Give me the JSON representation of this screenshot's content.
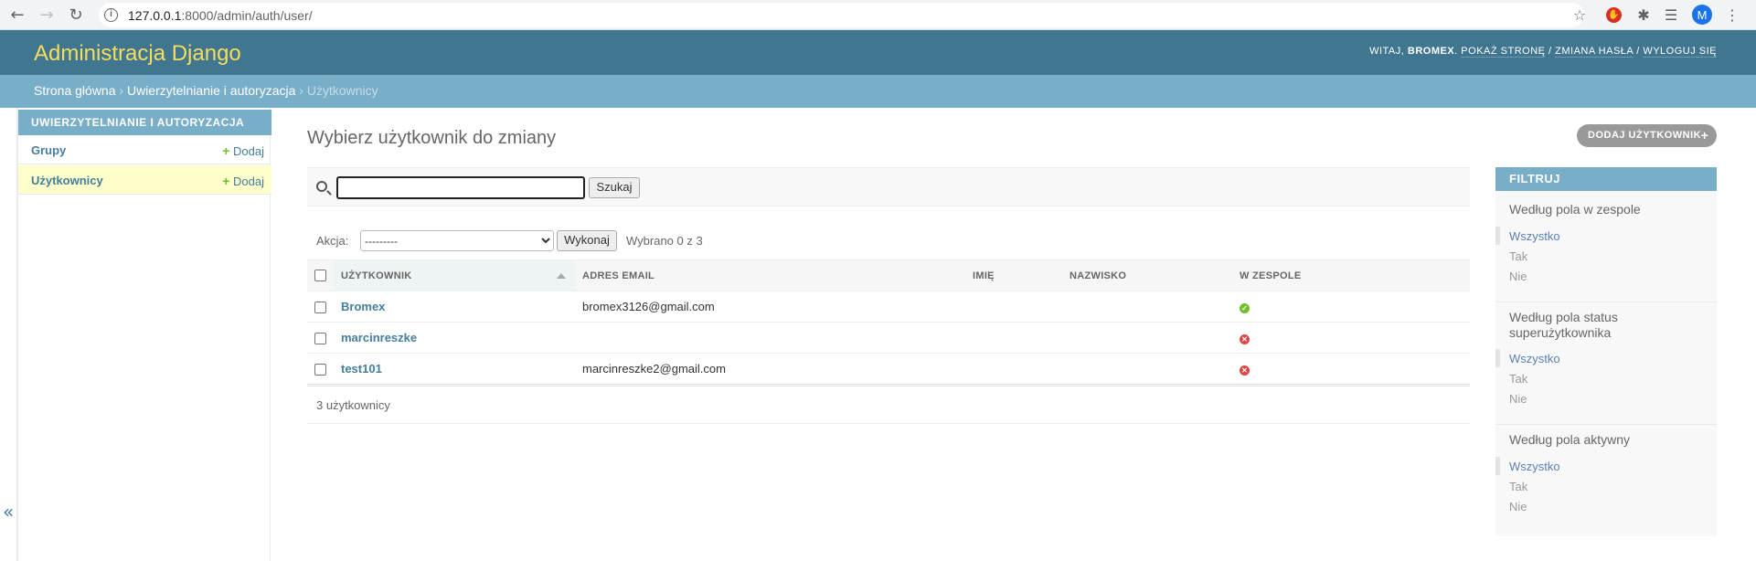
{
  "browser": {
    "url_host": "127.0.0.1",
    "url_rest": ":8000/admin/auth/user/",
    "profile_initial": "M"
  },
  "header": {
    "branding": "Administracja Django",
    "welcome": "WITAJ,",
    "username": "BROMEX",
    "links": [
      "POKAŻ STRONĘ",
      "ZMIANA HASŁA",
      "WYLOGUJ SIĘ"
    ]
  },
  "breadcrumbs": {
    "home": "Strona główna",
    "app": "Uwierzytelnianie i autoryzacja",
    "current": "Użytkownicy"
  },
  "sidebar": {
    "caption": "UWIERZYTELNIANIE I AUTORYZACJA",
    "items": [
      {
        "label": "Grupy",
        "add": "Dodaj"
      },
      {
        "label": "Użytkownicy",
        "add": "Dodaj"
      }
    ],
    "collapse": "«"
  },
  "main": {
    "title": "Wybierz użytkownik do zmiany",
    "add_button": "DODAJ UŻYTKOWNIK",
    "search_value": "",
    "search_button": "Szukaj",
    "action_label": "Akcja:",
    "action_selected": "---------",
    "go_button": "Wykonaj",
    "selected_counter": "Wybrano 0 z 3",
    "columns": [
      "UŻYTKOWNIK",
      "ADRES EMAIL",
      "IMIĘ",
      "NAZWISKO",
      "W ZESPOLE"
    ],
    "rows": [
      {
        "username": "Bromex",
        "email": "bromex3126@gmail.com",
        "first_name": "",
        "last_name": "",
        "is_staff": true
      },
      {
        "username": "marcinreszke",
        "email": "",
        "first_name": "",
        "last_name": "",
        "is_staff": false
      },
      {
        "username": "test101",
        "email": "marcinreszke2@gmail.com",
        "first_name": "",
        "last_name": "",
        "is_staff": false
      }
    ],
    "paginator": "3 użytkownicy"
  },
  "filter": {
    "caption": "FILTRUJ",
    "groups": [
      {
        "title": "Według pola w zespole",
        "options": [
          "Wszystko",
          "Tak",
          "Nie"
        ]
      },
      {
        "title": "Według pola status superużytkownika",
        "options": [
          "Wszystko",
          "Tak",
          "Nie"
        ]
      },
      {
        "title": "Według pola aktywny",
        "options": [
          "Wszystko",
          "Tak",
          "Nie"
        ]
      }
    ]
  },
  "colors": {
    "header_bg": "#417690",
    "breadcrumb_bg": "#79aec8",
    "branding": "#f5dd5d",
    "link": "#447e9b",
    "yes": "#70bf2b",
    "no": "#dd4646"
  }
}
